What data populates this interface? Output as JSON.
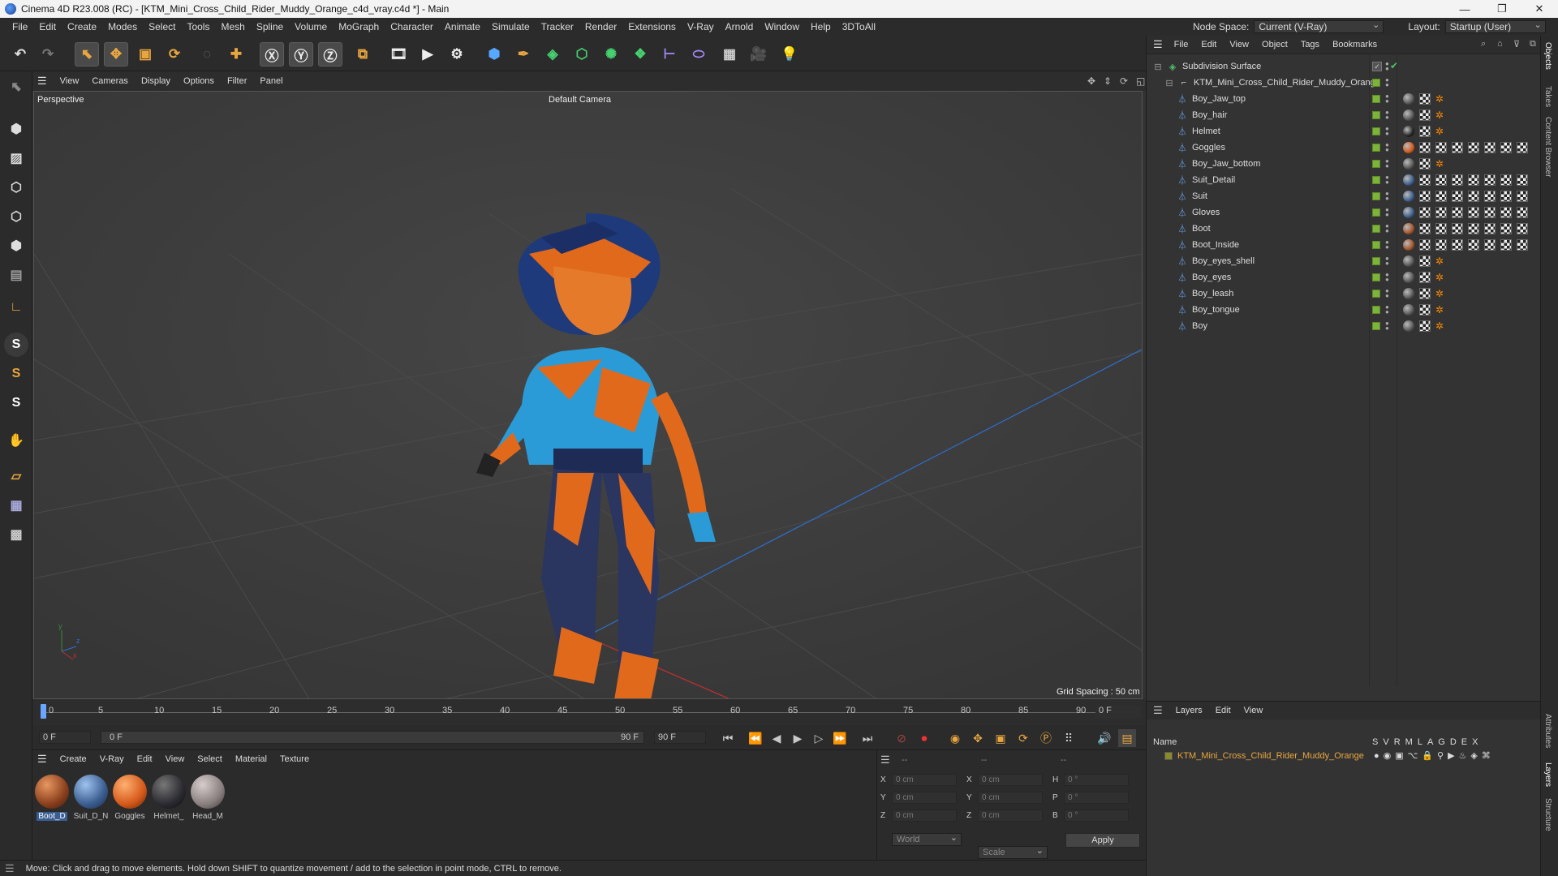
{
  "window": {
    "title": "Cinema 4D R23.008 (RC) - [KTM_Mini_Cross_Child_Rider_Muddy_Orange_c4d_vray.c4d *] - Main"
  },
  "menu": {
    "items": [
      "File",
      "Edit",
      "Create",
      "Modes",
      "Select",
      "Tools",
      "Mesh",
      "Spline",
      "Volume",
      "MoGraph",
      "Character",
      "Animate",
      "Simulate",
      "Tracker",
      "Render",
      "Extensions",
      "V-Ray",
      "Arnold",
      "Window",
      "Help",
      "3DToAll"
    ],
    "node_space_label": "Node Space:",
    "node_space_value": "Current (V-Ray)",
    "layout_label": "Layout:",
    "layout_value": "Startup (User)"
  },
  "viewport": {
    "menu": [
      "View",
      "Cameras",
      "Display",
      "Options",
      "Filter",
      "Panel"
    ],
    "label": "Perspective",
    "camera": "Default Camera",
    "grid_spacing": "Grid Spacing : 50 cm",
    "axis_y": "y",
    "axis_z": "z",
    "axis_x": "x"
  },
  "timeline": {
    "ticks": [
      "0",
      "5",
      "10",
      "15",
      "20",
      "25",
      "30",
      "35",
      "40",
      "45",
      "50",
      "55",
      "60",
      "65",
      "70",
      "75",
      "80",
      "85",
      "90"
    ],
    "current_frame": "0 F",
    "start_frame": "0 F",
    "range_start": "0 F",
    "range_end": "90 F",
    "end_frame": "90 F"
  },
  "materials": {
    "menu": [
      "Create",
      "V-Ray",
      "Edit",
      "View",
      "Select",
      "Material",
      "Texture"
    ],
    "items": [
      {
        "label": "Boot_D",
        "color": "#b25a2a"
      },
      {
        "label": "Suit_D_N",
        "color": "#4a6fa0"
      },
      {
        "label": "Goggles",
        "color": "#e06a1a"
      },
      {
        "label": "Helmet_",
        "color": "#2a2a30"
      },
      {
        "label": "Head_M",
        "color": "#8a8080"
      }
    ]
  },
  "attributes": {
    "header": [
      "--",
      "--",
      "--"
    ],
    "rows": [
      {
        "a": "X",
        "av": "0 cm",
        "b": "X",
        "bv": "0 cm",
        "c": "H",
        "cv": "0 °"
      },
      {
        "a": "Y",
        "av": "0 cm",
        "b": "Y",
        "bv": "0 cm",
        "c": "P",
        "cv": "0 °"
      },
      {
        "a": "Z",
        "av": "0 cm",
        "b": "Z",
        "bv": "0 cm",
        "c": "B",
        "cv": "0 °"
      }
    ],
    "coord_mode": "World",
    "size_mode": "Scale",
    "apply": "Apply"
  },
  "status": {
    "text": "Move: Click and drag to move elements. Hold down SHIFT to quantize movement / add to the selection in point mode, CTRL to remove."
  },
  "objects": {
    "menu": [
      "File",
      "Edit",
      "View",
      "Object",
      "Tags",
      "Bookmarks"
    ],
    "root": "Subdivision Surface",
    "group": "KTM_Mini_Cross_Child_Rider_Muddy_Orange",
    "items": [
      {
        "name": "Boy_Jaw_top",
        "tex": 1,
        "ball": "#555"
      },
      {
        "name": "Boy_hair",
        "tex": 1,
        "ball": "#555"
      },
      {
        "name": "Helmet",
        "tex": 1,
        "ball": "#222"
      },
      {
        "name": "Goggles",
        "tex": 7,
        "ball": "#d4591a"
      },
      {
        "name": "Boy_Jaw_bottom",
        "tex": 1,
        "ball": "#555"
      },
      {
        "name": "Suit_Detail",
        "tex": 7,
        "ball": "#3b5d8a"
      },
      {
        "name": "Suit",
        "tex": 7,
        "ball": "#3b5d8a"
      },
      {
        "name": "Gloves",
        "tex": 7,
        "ball": "#3b5d8a"
      },
      {
        "name": "Boot",
        "tex": 7,
        "ball": "#a2532a"
      },
      {
        "name": "Boot_Inside",
        "tex": 7,
        "ball": "#a2532a"
      },
      {
        "name": "Boy_eyes_shell",
        "tex": 1,
        "ball": "#555"
      },
      {
        "name": "Boy_eyes",
        "tex": 1,
        "ball": "#555"
      },
      {
        "name": "Boy_leash",
        "tex": 1,
        "ball": "#555"
      },
      {
        "name": "Boy_tongue",
        "tex": 1,
        "ball": "#555"
      },
      {
        "name": "Boy",
        "tex": 1,
        "ball": "#555"
      }
    ]
  },
  "layers": {
    "menu": [
      "Layers",
      "Edit",
      "View"
    ],
    "col_name": "Name",
    "cols": [
      "S",
      "V",
      "R",
      "M",
      "L",
      "A",
      "G",
      "D",
      "E",
      "X"
    ],
    "row": "KTM_Mini_Cross_Child_Rider_Muddy_Orange"
  },
  "right_tabs": [
    "Objects",
    "Takes",
    "Content Browser",
    "Attributes",
    "Layers",
    "Structure"
  ]
}
